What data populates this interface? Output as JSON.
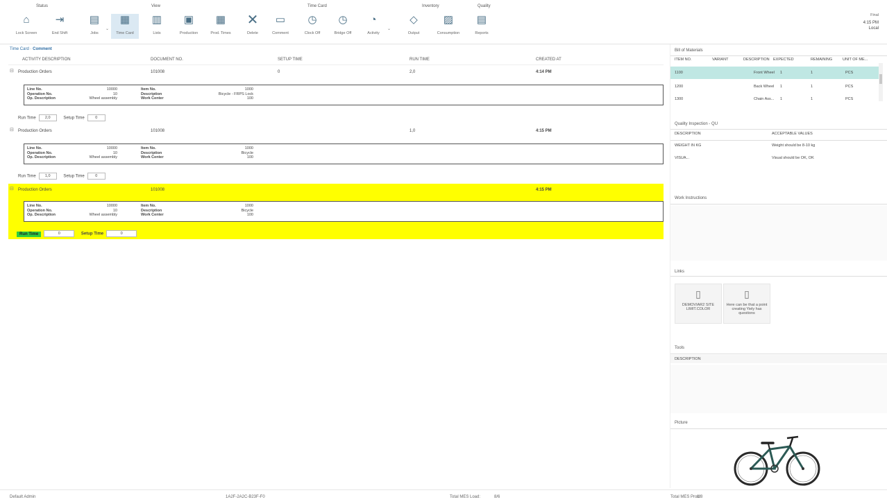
{
  "ribbon": {
    "groups": {
      "status": "Status",
      "view": "View",
      "time_card": "Time Card",
      "inventory": "Inventory",
      "quality": "Quality"
    },
    "buttons": {
      "lock_screen": "Lock Screen",
      "end_shift": "End Shift",
      "jobs": "Jobs",
      "time_card": "Time Card",
      "lists": "Lists",
      "production": "Production",
      "prod_times": "Prod. Times",
      "delete": "Delete",
      "comment": "Comment",
      "clock_off": "Clock Off",
      "bridge_off": "Bridge Off",
      "activity": "Activity",
      "output": "Output",
      "consumption": "Consumption",
      "reports": "Reports"
    },
    "final": {
      "title": "Final",
      "time": "4:15 PM",
      "status": "Local"
    }
  },
  "breadcrumb": {
    "first": "Time Card",
    "second": "Comment"
  },
  "columns": [
    "ACTIVITY DESCRIPTION",
    "DOCUMENT NO.",
    "SETUP TIME",
    "RUN TIME",
    "CREATED AT"
  ],
  "entries": [
    {
      "activity": "Production Orders",
      "document_no": "101008",
      "setup": "0",
      "run": "2,0",
      "created": "4:14 PM",
      "card": {
        "line_no": "10000",
        "op_no": "10",
        "op_desc": "Wheel assembly",
        "item_no": "1000",
        "desc": "Bicycle - FRPS Lock",
        "work_center": "100"
      },
      "run_time": "2,0",
      "setup_time": "0"
    },
    {
      "activity": "Production Orders",
      "document_no": "101008",
      "setup": "",
      "run": "1,0",
      "created": "4:15 PM",
      "card": {
        "line_no": "10000",
        "op_no": "10",
        "op_desc": "Wheel assembly",
        "item_no": "1000",
        "desc": "Bicycle",
        "work_center": "100"
      },
      "run_time": "1,0",
      "setup_time": "0"
    },
    {
      "activity": "Production Orders",
      "document_no": "101008",
      "setup": "",
      "run": "",
      "created": "4:15 PM",
      "card": {
        "line_no": "10000",
        "op_no": "10",
        "op_desc": "Wheel assembly",
        "item_no": "1000",
        "desc": "Bicycle",
        "work_center": "100"
      },
      "run_time": "0",
      "setup_time": "0"
    }
  ],
  "card_labels": {
    "line_no": "Line No.",
    "op_no": "Operation No.",
    "op_desc": "Op. Description",
    "item_no": "Item No.",
    "desc": "Description",
    "work_center": "Work Center",
    "run_time": "Run Time",
    "setup_time": "Setup Time"
  },
  "bom": {
    "title": "Bill of Materials",
    "headers": [
      "ITEM NO.",
      "VARIANT",
      "DESCRIPTION",
      "EXPECTED",
      "REMAINING",
      "UNIT OF ME..."
    ],
    "rows": [
      {
        "item": "1100",
        "variant": "",
        "desc": "Front Wheel",
        "expected": "1",
        "remaining": "1",
        "unit": "PCS"
      },
      {
        "item": "1200",
        "variant": "",
        "desc": "Back Wheel",
        "expected": "1",
        "remaining": "1",
        "unit": "PCS"
      },
      {
        "item": "1300",
        "variant": "",
        "desc": "Chain Ass...",
        "expected": "1",
        "remaining": "1",
        "unit": "PCS"
      }
    ]
  },
  "quality": {
    "title": "Quality Inspection - QU",
    "headers": [
      "DESCRIPTION",
      "ACCEPTABLE VALUES"
    ],
    "rows": [
      {
        "desc": "WEIGHT IN KG",
        "value": "Weight should be 8-10 kg"
      },
      {
        "desc": "VISUA...",
        "value": "Visual should be OK, OK"
      }
    ]
  },
  "work_instructions": {
    "title": "Work Instructions"
  },
  "links": {
    "title": "Links",
    "items": [
      "DEMOVIAR2 SITE LIMIT.COLOR",
      "Here can be that a point creating Yiely has questions"
    ]
  },
  "tools": {
    "title": "Tools",
    "header": "DESCRIPTION"
  },
  "picture": {
    "title": "Picture"
  },
  "status": {
    "user": "Default Admin",
    "code": "1A2F-2A2C-B23F-F0",
    "mid_label": "Total MES Load:",
    "mid_value": "8/6",
    "right_label": "Total MES Prod:",
    "right_value": "1/8"
  },
  "colors": {
    "highlight": "#ffff00",
    "green": "#2ecc40",
    "selected_row": "#bfe7e3",
    "accent": "#2e6da4"
  }
}
